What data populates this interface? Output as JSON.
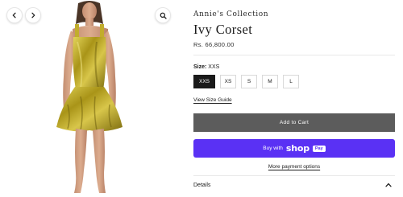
{
  "gallery": {
    "prev_icon": "chevron-left-icon",
    "next_icon": "chevron-right-icon",
    "zoom_icon": "magnifier-icon",
    "dress_color": "#b9a626"
  },
  "product": {
    "vendor": "Annie's Collection",
    "title": "Ivy Corset",
    "price": "Rs. 66,800.00"
  },
  "size": {
    "label": "Size:",
    "selected": "XXS",
    "options": [
      "XXS",
      "XS",
      "S",
      "M",
      "L"
    ],
    "guide_link": "View Size Guide"
  },
  "actions": {
    "add_to_cart": "Add to Cart",
    "buy_with": "Buy with",
    "shop_brand": "shop",
    "pay_badge": "Pay",
    "more_payment": "More payment options",
    "add_to_cart_color": "#5c5c5c",
    "shop_pay_color": "#5a31f4"
  },
  "details": {
    "label": "Details",
    "toggle_icon": "chevron-up-icon"
  }
}
